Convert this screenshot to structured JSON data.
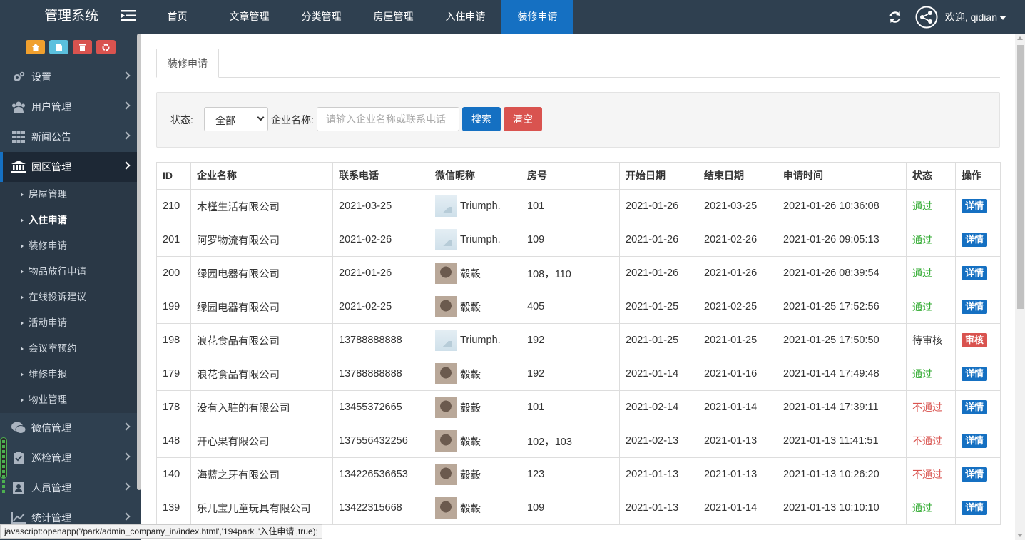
{
  "app": {
    "title": "管理系统"
  },
  "topnav": {
    "items": [
      {
        "label": "首页"
      },
      {
        "label": "文章管理"
      },
      {
        "label": "分类管理"
      },
      {
        "label": "房屋管理"
      },
      {
        "label": "入住申请"
      },
      {
        "label": "装修申请"
      }
    ],
    "active_index": 5
  },
  "user": {
    "welcome": "欢迎, qidian"
  },
  "sidebar": {
    "items": [
      {
        "label": "设置",
        "icon": "gears-icon"
      },
      {
        "label": "用户管理",
        "icon": "users-icon"
      },
      {
        "label": "新闻公告",
        "icon": "grid-icon"
      },
      {
        "label": "园区管理",
        "icon": "bank-icon"
      }
    ],
    "sub_items": [
      {
        "label": "房屋管理"
      },
      {
        "label": "入住申请"
      },
      {
        "label": "装修申请"
      },
      {
        "label": "物品放行申请"
      },
      {
        "label": "在线投诉建议"
      },
      {
        "label": "活动申请"
      },
      {
        "label": "会议室预约"
      },
      {
        "label": "维修申报"
      },
      {
        "label": "物业管理"
      }
    ],
    "bottom_items": [
      {
        "label": "微信管理",
        "icon": "wechat-icon"
      },
      {
        "label": "巡检管理",
        "icon": "checklist-icon"
      },
      {
        "label": "人员管理",
        "icon": "id-card-icon"
      },
      {
        "label": "统计管理",
        "icon": "chart-icon"
      }
    ]
  },
  "tab": {
    "label": "装修申请"
  },
  "filter": {
    "status_label": "状态:",
    "status_value": "全部",
    "company_label": "企业名称:",
    "company_placeholder": "请输入企业名称或联系电话",
    "search_button": "搜索",
    "clear_button": "清空"
  },
  "table": {
    "headers": [
      "ID",
      "企业名称",
      "联系电话",
      "微信昵称",
      "房号",
      "开始日期",
      "结束日期",
      "申请时间",
      "状态",
      "操作"
    ],
    "rows": [
      {
        "id": "210",
        "company": "木槿生活有限公司",
        "phone": "2021-03-25",
        "wx_name": "Triumph.",
        "wx_avatar": "landscape",
        "room": "101",
        "start": "2021-01-26",
        "end": "2021-03-25",
        "applied": "2021-01-26 10:36:08",
        "status": "通过",
        "status_type": "pass",
        "action": "详情",
        "action_type": "detail"
      },
      {
        "id": "201",
        "company": "阿罗物流有限公司",
        "phone": "2021-02-26",
        "wx_name": "Triumph.",
        "wx_avatar": "landscape",
        "room": "109",
        "start": "2021-01-26",
        "end": "2021-02-26",
        "applied": "2021-01-26 09:05:13",
        "status": "通过",
        "status_type": "pass",
        "action": "详情",
        "action_type": "detail"
      },
      {
        "id": "200",
        "company": "绿园电器有限公司",
        "phone": "2021-01-26",
        "wx_name": "毂毂",
        "wx_avatar": "dog",
        "room": "108，110",
        "start": "2021-01-26",
        "end": "2021-01-26",
        "applied": "2021-01-26 08:39:54",
        "status": "通过",
        "status_type": "pass",
        "action": "详情",
        "action_type": "detail"
      },
      {
        "id": "199",
        "company": "绿园电器有限公司",
        "phone": "2021-02-25",
        "wx_name": "毂毂",
        "wx_avatar": "dog",
        "room": "405",
        "start": "2021-01-25",
        "end": "2021-02-25",
        "applied": "2021-01-25 17:52:56",
        "status": "通过",
        "status_type": "pass",
        "action": "详情",
        "action_type": "detail"
      },
      {
        "id": "198",
        "company": "浪花食品有限公司",
        "phone": "13788888888",
        "wx_name": "Triumph.",
        "wx_avatar": "landscape",
        "room": "192",
        "start": "2021-01-25",
        "end": "2021-01-25",
        "applied": "2021-01-25 17:50:50",
        "status": "待审核",
        "status_type": "pend",
        "action": "审核",
        "action_type": "review"
      },
      {
        "id": "179",
        "company": "浪花食品有限公司",
        "phone": "13788888888",
        "wx_name": "毂毂",
        "wx_avatar": "dog",
        "room": "192",
        "start": "2021-01-14",
        "end": "2021-01-16",
        "applied": "2021-01-14 17:49:48",
        "status": "通过",
        "status_type": "pass",
        "action": "详情",
        "action_type": "detail"
      },
      {
        "id": "178",
        "company": "没有入驻的有限公司",
        "phone": "13455372665",
        "wx_name": "毂毂",
        "wx_avatar": "dog",
        "room": "101",
        "start": "2021-02-14",
        "end": "2021-01-14",
        "applied": "2021-01-14 17:39:11",
        "status": "不通过",
        "status_type": "fail",
        "action": "详情",
        "action_type": "detail"
      },
      {
        "id": "148",
        "company": "开心果有限公司",
        "phone": "137556432256",
        "wx_name": "毂毂",
        "wx_avatar": "dog",
        "room": "102，103",
        "start": "2021-02-13",
        "end": "2021-01-13",
        "applied": "2021-01-13 11:41:51",
        "status": "不通过",
        "status_type": "fail",
        "action": "详情",
        "action_type": "detail"
      },
      {
        "id": "140",
        "company": "海蓝之牙有限公司",
        "phone": "134226536653",
        "wx_name": "毂毂",
        "wx_avatar": "dog",
        "room": "123",
        "start": "2021-01-13",
        "end": "2021-01-13",
        "applied": "2021-01-13 10:26:20",
        "status": "不通过",
        "status_type": "fail",
        "action": "详情",
        "action_type": "detail"
      },
      {
        "id": "139",
        "company": "乐儿宝儿童玩具有限公司",
        "phone": "13422315668",
        "wx_name": "毂毂",
        "wx_avatar": "dog",
        "room": "109",
        "start": "2021-01-13",
        "end": "2021-01-14",
        "applied": "2021-01-13 10:10:10",
        "status": "通过",
        "status_type": "pass",
        "action": "详情",
        "action_type": "detail"
      }
    ]
  },
  "status_bar": {
    "url": "javascript:openapp('/park/admin_company_in/index.html','194park','入住申请',true);"
  },
  "colors": {
    "sidebar": "#2f4050",
    "primary": "#1570c2",
    "danger": "#d9534f",
    "pass": "#2eaa2e"
  }
}
